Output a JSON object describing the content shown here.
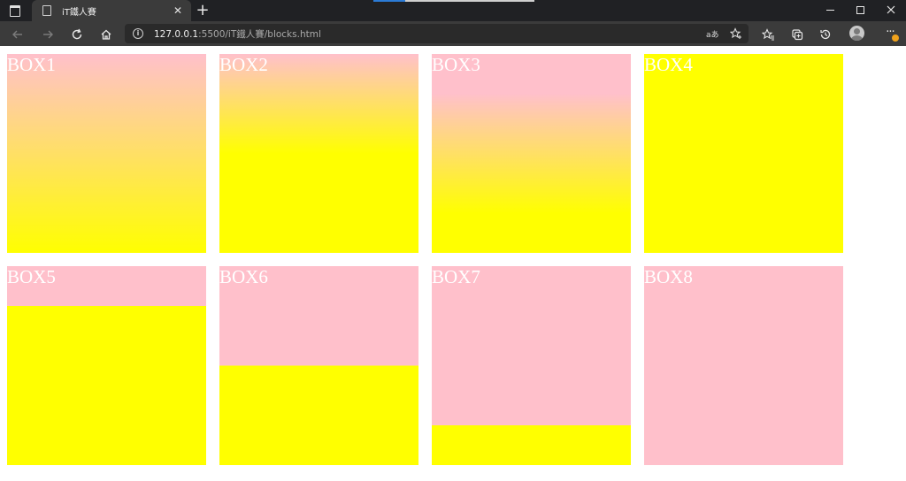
{
  "browser": {
    "tab": {
      "title": "iT鐵人賽",
      "close_symbol": "✕"
    },
    "new_tab_symbol": "+",
    "address": {
      "host": "127.0.0.1",
      "path": ":5500/iT鐵人賽/blocks.html"
    },
    "toolbar_icons": [
      "back-icon",
      "forward-icon",
      "refresh-icon",
      "home-icon",
      "info-icon",
      "read-aloud-icon",
      "add-favorite-icon",
      "favorites-icon",
      "collections-icon",
      "history-icon",
      "profile-icon",
      "more-icon"
    ],
    "window_controls": [
      "minimize",
      "restore",
      "close"
    ]
  },
  "page": {
    "boxes": [
      {
        "label": "BOX1",
        "fill": "gradient-full"
      },
      {
        "label": "BOX2",
        "fill": "gradient-upper"
      },
      {
        "label": "BOX3",
        "fill": "gradient-middle"
      },
      {
        "label": "BOX4",
        "fill": "solid-yellow"
      },
      {
        "label": "BOX5",
        "fill": "hard-stop",
        "pink_fraction": 0.2
      },
      {
        "label": "BOX6",
        "fill": "hard-stop",
        "pink_fraction": 0.5
      },
      {
        "label": "BOX7",
        "fill": "hard-stop",
        "pink_fraction": 0.8
      },
      {
        "label": "BOX8",
        "fill": "solid-pink"
      }
    ],
    "colors": {
      "pink": "#ffc0cb",
      "yellow": "#ffff00",
      "label": "#ffffff"
    }
  }
}
